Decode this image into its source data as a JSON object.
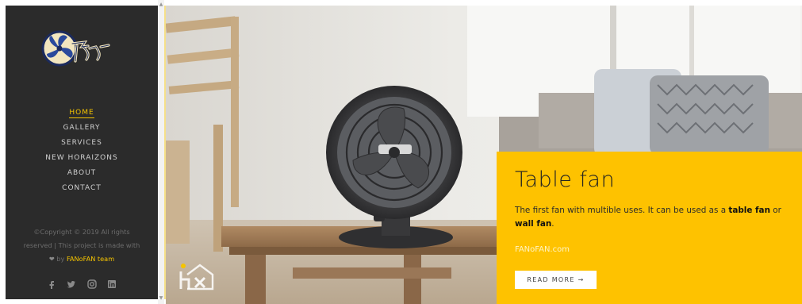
{
  "sidebar": {
    "logo_alt": "FANoFAN logo",
    "nav": [
      {
        "label": "HOME",
        "active": true
      },
      {
        "label": "GALLERY",
        "active": false
      },
      {
        "label": "SERVICES",
        "active": false
      },
      {
        "label": "NEW HORAIZONS",
        "active": false
      },
      {
        "label": "ABOUT",
        "active": false
      },
      {
        "label": "CONTACT",
        "active": false
      }
    ],
    "copyright_line1": "©Copyright © 2019 All rights",
    "copyright_line2": "reserved | This project is made with",
    "copyright_by": "by",
    "copyright_team": "FANoFAN team",
    "social_icons": [
      "facebook-icon",
      "twitter-icon",
      "instagram-icon",
      "linkedin-icon"
    ]
  },
  "hero": {
    "title": "Table fan",
    "text_part1": "The first fan with multible uses. It can be used as a ",
    "text_bold1": "table fan",
    "text_part2": " or ",
    "text_bold2": "wall fan",
    "text_part3": ".",
    "site": "FANoFAN.com",
    "button_label": "READ MORE →"
  },
  "colors": {
    "sidebar_bg": "#2b2b2b",
    "accent": "#f5c400",
    "card_bg": "#fec200"
  }
}
